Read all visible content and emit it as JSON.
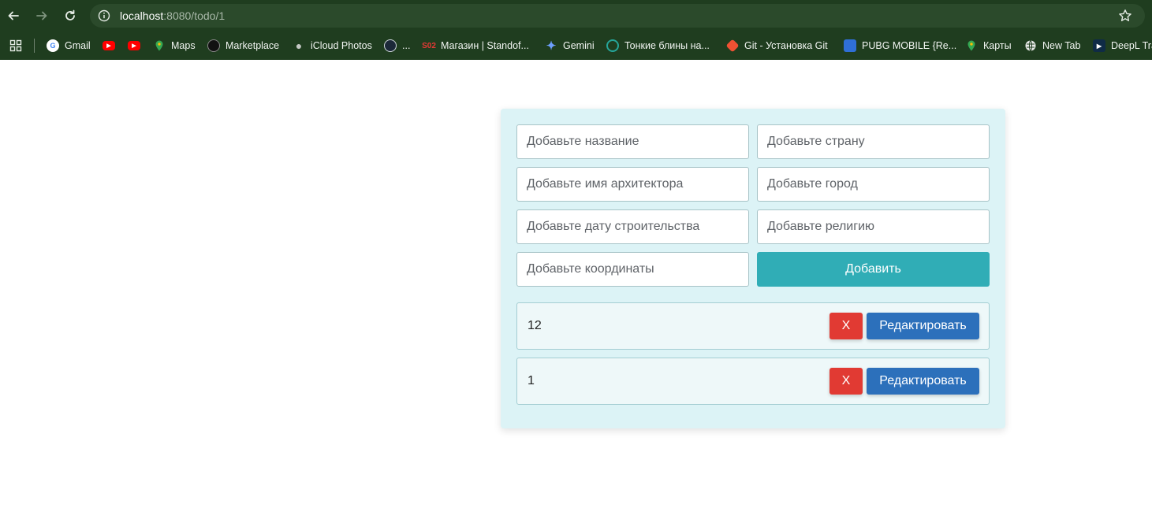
{
  "browser": {
    "url_host": "localhost",
    "url_path": ":8080/todo/1",
    "bookmarks": [
      {
        "label": "Gmail",
        "icon": "google-icon",
        "color": "#ffffff"
      },
      {
        "label": "",
        "icon": "youtube-icon",
        "color": "#ff0000"
      },
      {
        "label": "",
        "icon": "youtube-icon",
        "color": "#ff0000"
      },
      {
        "label": "Maps",
        "icon": "maps-pin-icon",
        "color": "#34a853"
      },
      {
        "label": "Marketplace",
        "icon": "github-icon",
        "color": "#111111"
      },
      {
        "label": "iCloud Photos",
        "icon": "apple-icon",
        "color": "#9aa09a"
      },
      {
        "label": "...",
        "icon": "steam-icon",
        "color": "#1b2838"
      },
      {
        "label": "Магазин | Standof...",
        "icon": "so2-icon",
        "color": "#c62828"
      },
      {
        "label": "Gemini",
        "icon": "gemini-icon",
        "color": "#4f8df5"
      },
      {
        "label": "Тонкие блины на...",
        "icon": "swirl-icon",
        "color": "#26a69a"
      },
      {
        "label": "Git - Установка Git",
        "icon": "git-icon",
        "color": "#f05133"
      },
      {
        "label": "PUBG MOBILE {Re...",
        "icon": "pubg-icon",
        "color": "#2f6fd6"
      },
      {
        "label": "Карты",
        "icon": "maps-pin-icon",
        "color": "#34a853"
      },
      {
        "label": "New Tab",
        "icon": "globe-icon",
        "color": "#e0e0e0"
      },
      {
        "label": "DeepL Tra",
        "icon": "deepl-icon",
        "color": "#0f2b46"
      }
    ]
  },
  "form": {
    "title_placeholder": "Добавьте название",
    "country_placeholder": "Добавьте страну",
    "architect_placeholder": "Добавьте имя архитектора",
    "city_placeholder": "Добавьте город",
    "date_placeholder": "Добавьте дату строительства",
    "religion_placeholder": "Добавьте религию",
    "coords_placeholder": "Добавьте координаты",
    "add_label": "Добавить"
  },
  "items": [
    {
      "title": "12",
      "delete_label": "X",
      "edit_label": "Редактировать"
    },
    {
      "title": "1",
      "delete_label": "X",
      "edit_label": "Редактировать"
    }
  ],
  "colors": {
    "chrome": "#1f3d1f",
    "card": "#dcf3f6",
    "add_button": "#30adb6",
    "delete_button": "#e13a33",
    "edit_button": "#2c70bb"
  }
}
